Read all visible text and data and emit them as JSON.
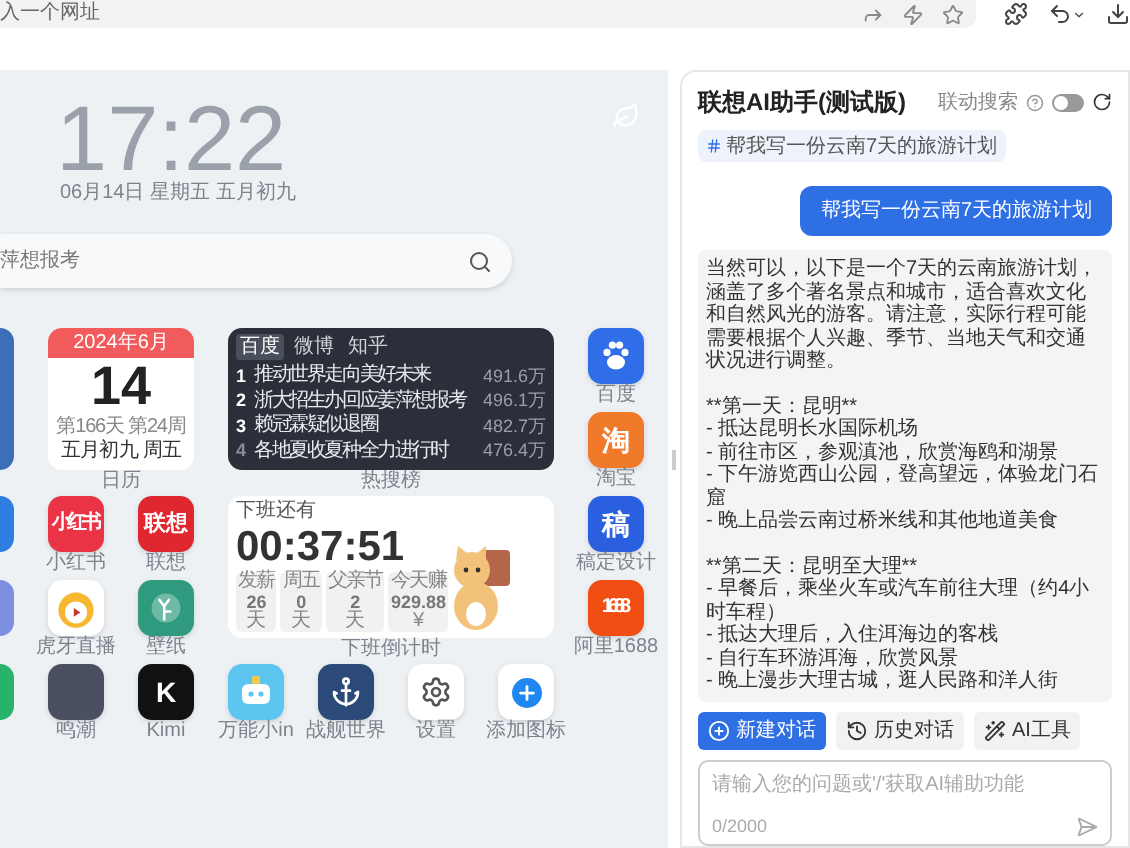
{
  "browser_bar": {
    "address_placeholder": "入一个网址"
  },
  "new_tab": {
    "clock": "17:22",
    "date": "06月14日 星期五 五月初九",
    "search": {
      "placeholder": "萍想报考"
    },
    "calendar": {
      "header": "2024年6月",
      "day": "14",
      "info": "第166天 第24周",
      "lunar": "五月初九 周五",
      "label": "日历"
    },
    "hot_list": {
      "label": "热搜榜",
      "tabs": [
        {
          "label": "百度",
          "selected": true
        },
        {
          "label": "微博",
          "selected": false
        },
        {
          "label": "知乎",
          "selected": false
        }
      ],
      "rows": [
        {
          "rank": "1",
          "title": "推动世界走向美好未来",
          "count": "491.6万",
          "top": true
        },
        {
          "rank": "2",
          "title": "浙大招生办回应姜萍想报考",
          "count": "496.1万",
          "top": true
        },
        {
          "rank": "3",
          "title": "赖冠霖疑似退圈",
          "count": "482.7万",
          "top": true
        },
        {
          "rank": "4",
          "title": "各地夏收夏种全力进行时",
          "count": "476.4万",
          "top": false
        }
      ]
    },
    "countdown": {
      "title": "下班还有",
      "time": "00:37:51",
      "label": "下班倒计时",
      "chips": [
        {
          "label": "发薪",
          "value": "26",
          "unit": "天"
        },
        {
          "label": "周五",
          "value": "0",
          "unit": "天"
        },
        {
          "label": "父亲节",
          "value": "2",
          "unit": "天"
        },
        {
          "label": "今天赚",
          "value": "929.88",
          "unit": "¥"
        }
      ]
    },
    "side_apps": [
      {
        "name": "百度",
        "kind": "paw",
        "color": "#2f6ee8"
      },
      {
        "name": "淘宝",
        "kind": "glyph",
        "glyph": "淘",
        "color": "#f07a2a"
      },
      {
        "name": "稿定设计",
        "kind": "glyph",
        "glyph": "稿",
        "color": "#2a5fe0"
      },
      {
        "name": "阿里1688",
        "kind": "glyph",
        "glyph": "1688",
        "color": "#f04e12"
      }
    ],
    "left_apps": [
      {
        "name": "小红书",
        "kind": "glyph",
        "glyph": "小红书",
        "color": "#ea3345"
      },
      {
        "name": "联想",
        "kind": "glyph",
        "glyph": "联想",
        "color": "#e0262f"
      },
      {
        "name": "虎牙直播",
        "kind": "mascot",
        "color": "#ffffff"
      },
      {
        "name": "壁纸",
        "kind": "deer",
        "color": "#2f9a7e"
      }
    ],
    "bottom_apps": [
      {
        "name": "鸣潮",
        "kind": "photo",
        "color": "#4a4f62"
      },
      {
        "name": "Kimi",
        "kind": "glyph",
        "glyph": "K",
        "color": "#111111"
      },
      {
        "name": "万能小in",
        "kind": "robot",
        "color": "#5cc6f0"
      },
      {
        "name": "战舰世界",
        "kind": "anchor",
        "color": "#2b4a7a"
      },
      {
        "name": "设置",
        "kind": "gear",
        "color": "#ffffff"
      },
      {
        "name": "添加图标",
        "kind": "add",
        "color": "#ffffff"
      }
    ]
  },
  "assistant": {
    "title": "联想AI助手(测试版)",
    "linked_search": {
      "label": "联动搜索",
      "on": false
    },
    "topic_tag": "帮我写一份云南7天的旅游计划",
    "messages": [
      {
        "kind": "user",
        "text": "帮我写一份云南7天的旅游计划"
      },
      {
        "kind": "assistant",
        "blocks": [
          [
            "当然可以，以下是一个7天的云南旅游计划，涵盖了多个著名景点和城市，适合喜欢文化和自然风光的游客。请注意，实际行程可能需要根据个人兴趣、季节、当地天气和交通状况进行调整。"
          ],
          [
            "**第一天：昆明**",
            "- 抵达昆明长水国际机场",
            "- 前往市区，参观滇池，欣赏海鸥和湖景",
            "- 下午游览西山公园，登高望远，体验龙门石窟",
            "- 晚上品尝云南过桥米线和其他地道美食"
          ],
          [
            "**第二天：昆明至大理**",
            "- 早餐后，乘坐火车或汽车前往大理（约4小时车程）",
            "- 抵达大理后，入住洱海边的客栈",
            "- 自行车环游洱海，欣赏风景",
            "- 晚上漫步大理古城，逛人民路和洋人街"
          ]
        ]
      }
    ],
    "actions": [
      {
        "label": "新建对话",
        "kind": "new"
      },
      {
        "label": "历史对话",
        "kind": "history"
      },
      {
        "label": "AI工具",
        "kind": "tools"
      }
    ],
    "input": {
      "placeholder": "请输入您的问题或'/'获取AI辅助功能",
      "counter": "0/2000"
    }
  }
}
